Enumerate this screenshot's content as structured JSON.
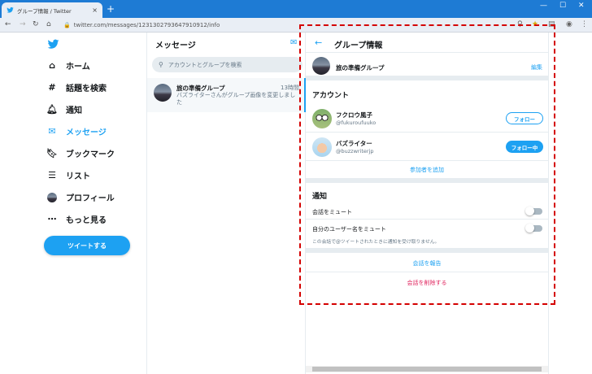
{
  "browser": {
    "tab_title": "グループ情報 / Twitter",
    "tab_close": "×",
    "new_tab": "+",
    "url": "twitter.com/messages/1231302793647910912/info"
  },
  "sidebar": {
    "items": [
      {
        "label": "ホーム",
        "icon": "home-icon"
      },
      {
        "label": "話題を検索",
        "icon": "hashtag-icon"
      },
      {
        "label": "通知",
        "icon": "bell-icon"
      },
      {
        "label": "メッセージ",
        "icon": "envelope-icon",
        "active": true
      },
      {
        "label": "ブックマーク",
        "icon": "bookmark-icon"
      },
      {
        "label": "リスト",
        "icon": "list-icon"
      },
      {
        "label": "プロフィール",
        "icon": "profile-avatar-icon"
      },
      {
        "label": "もっと見る",
        "icon": "more-icon"
      }
    ],
    "tweet_button": "ツイートする"
  },
  "messages": {
    "title": "メッセージ",
    "search_placeholder": "アカウントとグループを検索",
    "conversation": {
      "name": "旅の準備グループ",
      "time": "13時間",
      "snippet": "バズライターさんがグループ画像を変更しました"
    }
  },
  "group_info": {
    "title": "グループ情報",
    "group_name": "旅の準備グループ",
    "edit_label": "編集",
    "accounts_title": "アカウント",
    "members": [
      {
        "name": "フクロウ風子",
        "handle": "@fukuroufuuko",
        "button": "フォロー"
      },
      {
        "name": "バズライター",
        "handle": "@buzzwriterjp",
        "button": "フォロー中"
      }
    ],
    "add_participants": "参加者を追加",
    "notifications_title": "通知",
    "mute_conversation": "会話をミュート",
    "mute_mentions": "自分のユーザー名をミュート",
    "mute_note": "この会話で@ツイートされたときに通知を受け取りません。",
    "report": "会話を報告",
    "delete": "会話を削除する"
  },
  "colors": {
    "accent": "#1da1f2",
    "danger": "#e0245e",
    "highlight_border": "#d40000"
  }
}
